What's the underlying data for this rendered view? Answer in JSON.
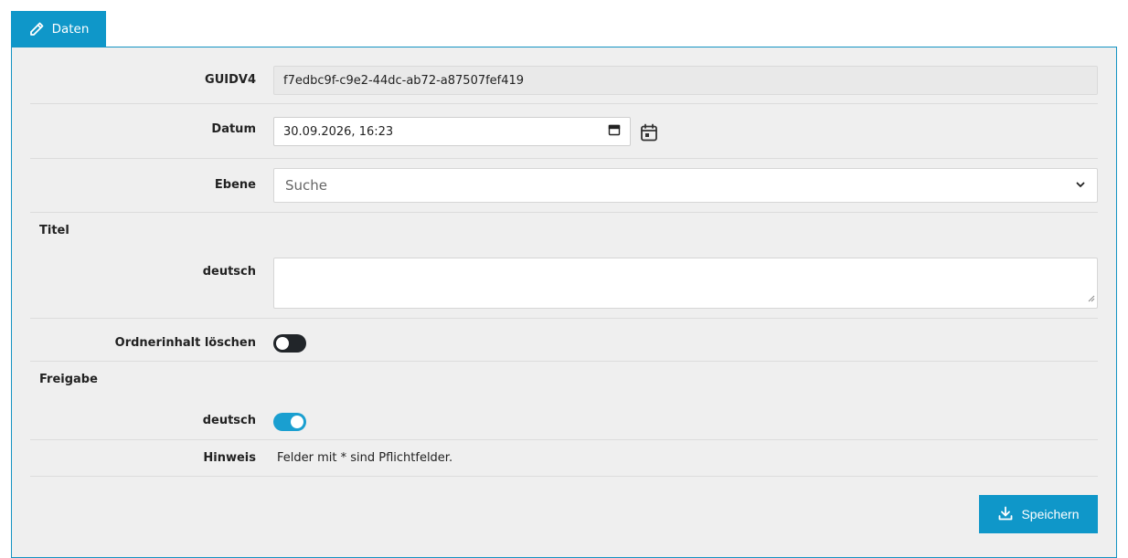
{
  "tab": {
    "label": "Daten",
    "icon": "pencil-icon"
  },
  "form": {
    "guid": {
      "label": "GUIDV4",
      "value": "f7edbc9f-c9e2-44dc-ab72-a87507fef419"
    },
    "datum": {
      "label": "Datum",
      "value": "30.09.2026, 16:23",
      "icon": "calendar-icon"
    },
    "ebene": {
      "label": "Ebene",
      "placeholder": "Suche",
      "icon": "chevron-down-icon"
    },
    "titel": {
      "section_label": "Titel",
      "lang_label": "deutsch",
      "value": ""
    },
    "ordnerinhalt": {
      "label": "Ordnerinhalt löschen",
      "checked": false
    },
    "freigabe": {
      "section_label": "Freigabe",
      "lang_label": "deutsch",
      "checked": true
    },
    "hinweis": {
      "label": "Hinweis",
      "text": "Felder mit * sind Pflichtfelder."
    }
  },
  "actions": {
    "save_label": "Speichern",
    "save_icon": "download-icon"
  },
  "colors": {
    "accent": "#0f97c9",
    "toggle_on": "#1a9fd0",
    "toggle_off": "#212529",
    "panel_bg": "#efefef"
  }
}
